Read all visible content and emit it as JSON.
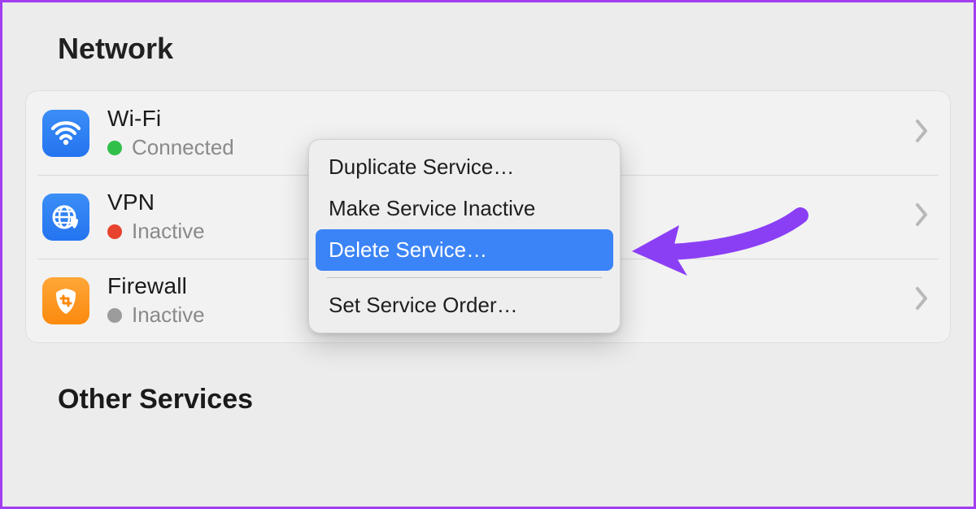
{
  "section_title": "Network",
  "other_title": "Other Services",
  "services": [
    {
      "name": "Wi-Fi",
      "status": "Connected",
      "dot": "green",
      "icon": "wifi"
    },
    {
      "name": "VPN",
      "status": "Inactive",
      "dot": "red",
      "icon": "globe"
    },
    {
      "name": "Firewall",
      "status": "Inactive",
      "dot": "grey",
      "icon": "shield"
    }
  ],
  "context_menu": {
    "items": [
      {
        "label": "Duplicate Service…",
        "selected": false
      },
      {
        "label": "Make Service Inactive",
        "selected": false
      },
      {
        "label": "Delete Service…",
        "selected": true
      }
    ],
    "after_separator": [
      {
        "label": "Set Service Order…",
        "selected": false
      }
    ]
  },
  "colors": {
    "highlight": "#3b84f7",
    "arrow": "#8a3ff5"
  }
}
